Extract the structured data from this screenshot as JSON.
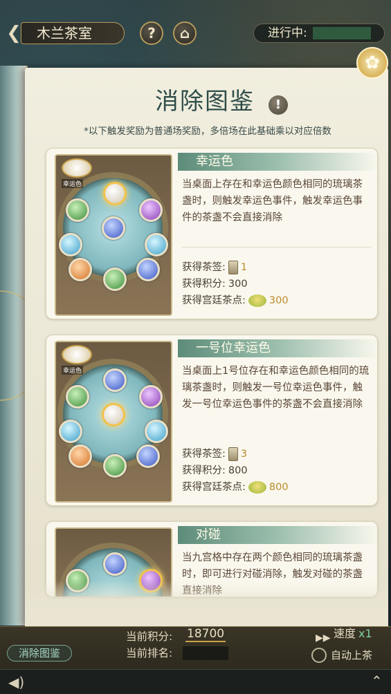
{
  "topbar": {
    "back_icon": "back-arrow-icon",
    "title": "木兰茶室",
    "help_label": "?",
    "home_icon": "home-icon",
    "status_label": "进行中:"
  },
  "book": {
    "title": "消除图鉴",
    "info_icon": "!",
    "subtitle": "*以下触发奖励为普通场奖励，多倍场在此基础乘以对应倍数",
    "corner_icon": "flower-icon"
  },
  "cards": [
    {
      "title": "幸运色",
      "tag_label": "幸运色",
      "description": "当桌面上存在和幸运色颜色相同的琉璃茶盏时，则触发幸运色事件，触发幸运色事件的茶盏不会直接消除",
      "rewards": {
        "tea_tag_label": "获得茶签:",
        "tea_tag_value": "1",
        "score_label": "获得积分:",
        "score_value": "300",
        "snack_label": "获得宫廷茶点:",
        "snack_value": "300"
      }
    },
    {
      "title": "一号位幸运色",
      "tag_label": "幸运色",
      "description": "当桌面上1号位存在和幸运色颜色相同的琉璃茶盏时，则触发一号位幸运色事件，触发一号位幸运色事件的茶盏不会直接消除",
      "rewards": {
        "tea_tag_label": "获得茶签:",
        "tea_tag_value": "3",
        "score_label": "获得积分:",
        "score_value": "800",
        "snack_label": "获得宫廷茶点:",
        "snack_value": "800"
      }
    },
    {
      "title": "对碰",
      "description": "当九宫格中存在两个颜色相同的琉璃茶盏时，即可进行对碰消除，触发对碰的茶盏直接消除"
    }
  ],
  "bottom": {
    "gallery_button": "消除图鉴",
    "score_label": "当前积分:",
    "score_value": "18700",
    "rank_label": "当前排名:",
    "speed_label": "速度",
    "speed_value": "x1",
    "auto_label": "自动上茶",
    "speaker_icon": "speaker-icon",
    "expand_icon": "chevron-up-icon"
  },
  "colors": {
    "accent_green": "#5d8c7a",
    "reward_gold": "#b98a2a",
    "title_teal": "#2f4d4a"
  }
}
